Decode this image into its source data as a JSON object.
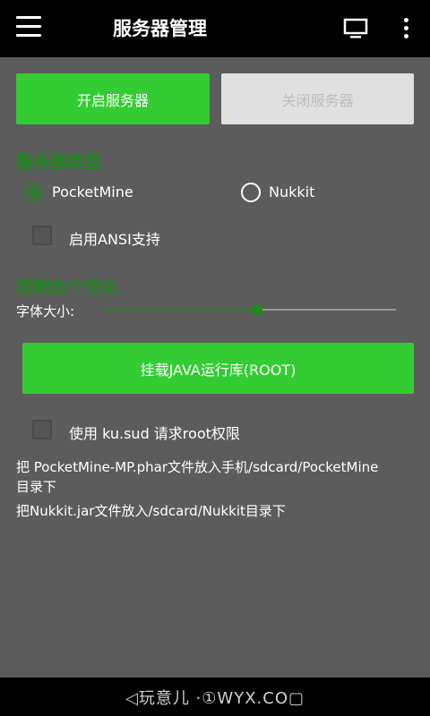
{
  "appbar": {
    "title": "服务器管理",
    "icons": [
      "menu-icon",
      "monitor-icon",
      "more-vert-icon"
    ]
  },
  "controls": {
    "start_label": "开启服务器",
    "stop_label": "关闭服务器"
  },
  "server_type": {
    "title": "服务器类型",
    "options": [
      {
        "label": "PocketMine",
        "selected": true
      },
      {
        "label": "Nukkit",
        "selected": false
      }
    ],
    "ansi_label": "启用ANSI支持",
    "ansi_checked": false
  },
  "console": {
    "title": "控制台个性化",
    "font_size_label": "字体大小:",
    "font_size_level": 0.53
  },
  "java": {
    "button_label": "挂载JAVA运行库(ROOT)"
  },
  "root": {
    "kusud_label": "使用 ku.sud 请求root权限",
    "kusud_checked": false
  },
  "info": {
    "pocketmine_line1": "把 PocketMine-MP.phar文件放入手机/sdcard/PocketMine",
    "pocketmine_line2": "目录下",
    "nukkit": "把Nukkit.jar文件放入/sdcard/Nukkit目录下"
  },
  "watermark": "◁玩意儿 ·①WYX.CO▢",
  "colors": {
    "accent": "#33cc33",
    "accent_dark": "#1f8a1f",
    "background": "#5c5c5c",
    "bar": "#000000"
  }
}
